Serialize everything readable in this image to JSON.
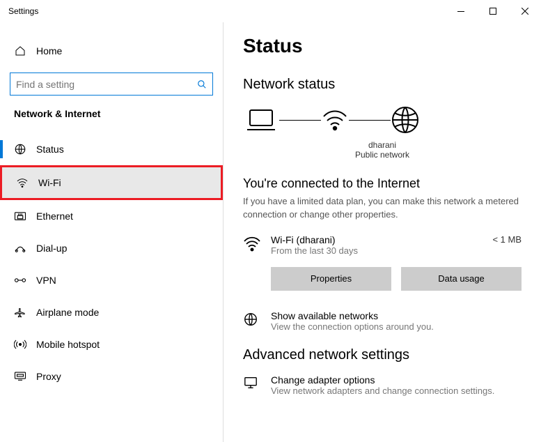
{
  "window": {
    "title": "Settings"
  },
  "sidebar": {
    "home": "Home",
    "search_placeholder": "Find a setting",
    "section": "Network & Internet",
    "items": [
      {
        "label": "Status"
      },
      {
        "label": "Wi-Fi"
      },
      {
        "label": "Ethernet"
      },
      {
        "label": "Dial-up"
      },
      {
        "label": "VPN"
      },
      {
        "label": "Airplane mode"
      },
      {
        "label": "Mobile hotspot"
      },
      {
        "label": "Proxy"
      }
    ]
  },
  "main": {
    "title": "Status",
    "network_status": "Network status",
    "diagram": {
      "ssid": "dharani",
      "type": "Public network"
    },
    "connected": {
      "title": "You're connected to the Internet",
      "desc": "If you have a limited data plan, you can make this network a metered connection or change other properties."
    },
    "connection": {
      "name": "Wi-Fi (dharani)",
      "sub": "From the last 30 days",
      "usage": "< 1 MB"
    },
    "buttons": {
      "properties": "Properties",
      "data_usage": "Data usage"
    },
    "show_networks": {
      "title": "Show available networks",
      "sub": "View the connection options around you."
    },
    "advanced": {
      "heading": "Advanced network settings",
      "adapter": {
        "title": "Change adapter options",
        "sub": "View network adapters and change connection settings."
      }
    }
  }
}
